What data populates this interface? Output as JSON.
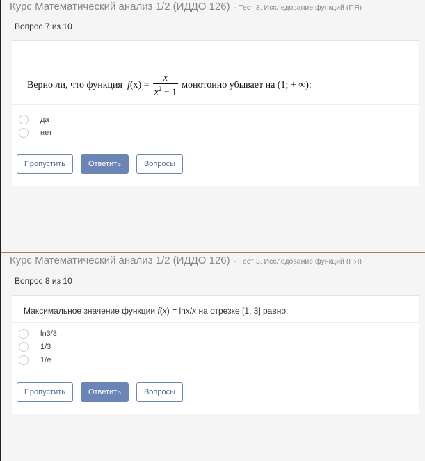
{
  "screen1": {
    "course_title": "Курс Математический анализ 1/2 (ИДДО 126)",
    "test_name": "- Тест 3. Исследование функций (ПЯ)",
    "question_counter": "Вопрос 7 из 10",
    "question": {
      "prefix": "Верно ли, что функция",
      "func_name": "f",
      "func_arg": "(x) =",
      "numerator": "x",
      "denominator_var": "x",
      "denominator_exp": "2",
      "denominator_rest": " − 1",
      "suffix": "монотонно убывает на (1; + ∞):"
    },
    "options": [
      "да",
      "нет"
    ],
    "buttons": {
      "skip": "Пропустить",
      "answer": "Ответить",
      "questions": "Вопросы"
    }
  },
  "screen2": {
    "course_title": "Курс Математический анализ 1/2 (ИДДО 126)",
    "test_name": "- Тест 3. Исследование функций (ПЯ)",
    "question_counter": "Вопрос 8 из 10",
    "question": {
      "prefix": "Максимальное значение функции ",
      "func": "f",
      "arg": "(",
      "var": "x",
      "eq": ") = ln",
      "var2": "x",
      "slash": "/",
      "var3": "x",
      "suffix": " на отрезке [1; 3] равно:"
    },
    "options": [
      {
        "pre": "ln3/3",
        "italic": ""
      },
      {
        "pre": "1/3",
        "italic": ""
      },
      {
        "pre": "1/",
        "italic": "e"
      }
    ],
    "buttons": {
      "skip": "Пропустить",
      "answer": "Ответить",
      "questions": "Вопросы"
    }
  },
  "colors": {
    "primary": "#6a85b6",
    "outline": "#6d86b3",
    "background": "#f5f5f5",
    "divider": "#b7774a"
  }
}
